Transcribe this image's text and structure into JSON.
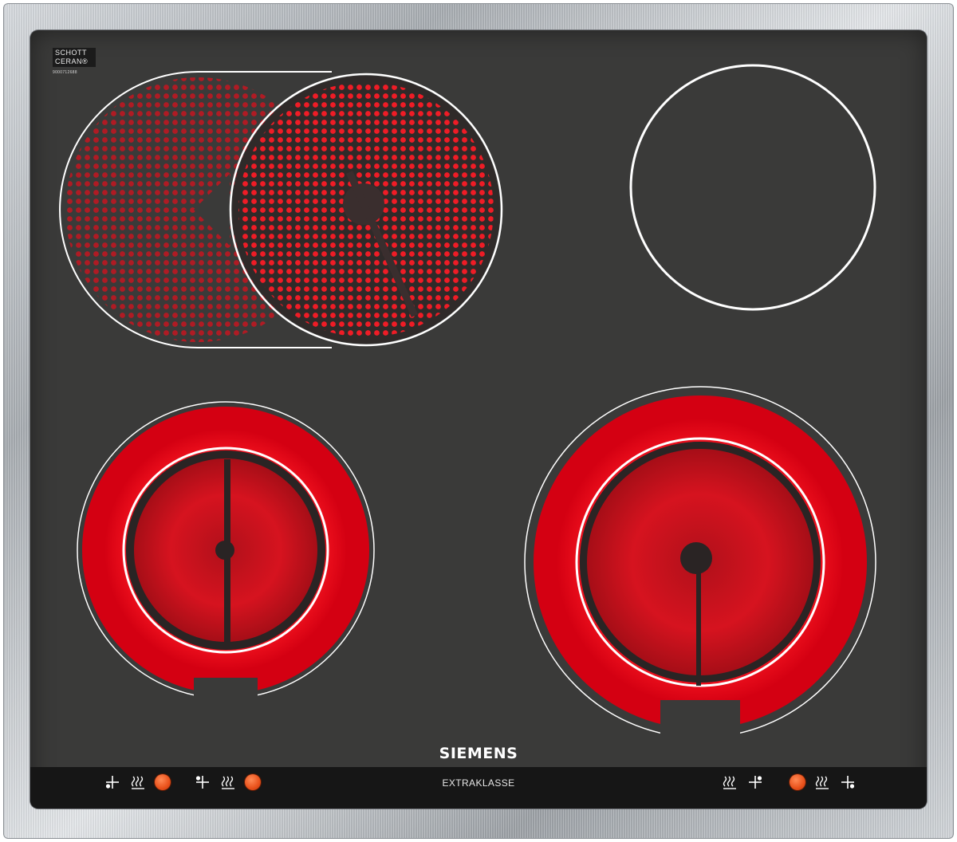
{
  "badge": {
    "line1": "SCHOTT",
    "line2": "CERAN®",
    "code": "9000712688"
  },
  "brand": "SIEMENS",
  "model_line": "EXTRAKLASSE",
  "colors": {
    "glass": "#3a3a39",
    "heating": "#e8001c",
    "knob": "#e8501a",
    "outline": "#ffffff"
  },
  "controls": [
    {
      "zone": "front-left",
      "icons": [
        "zone-position-front-left-icon",
        "heat-icon"
      ],
      "button": "knob"
    },
    {
      "zone": "rear-left",
      "icons": [
        "zone-position-rear-left-icon",
        "heat-icon"
      ],
      "button": "knob"
    },
    {
      "zone": "rear-right",
      "icons": [
        "heat-icon",
        "zone-position-rear-right-icon"
      ],
      "button": "knob"
    },
    {
      "zone": "front-right",
      "icons": [
        "heat-icon",
        "zone-position-front-right-icon"
      ],
      "button": "knob"
    }
  ]
}
